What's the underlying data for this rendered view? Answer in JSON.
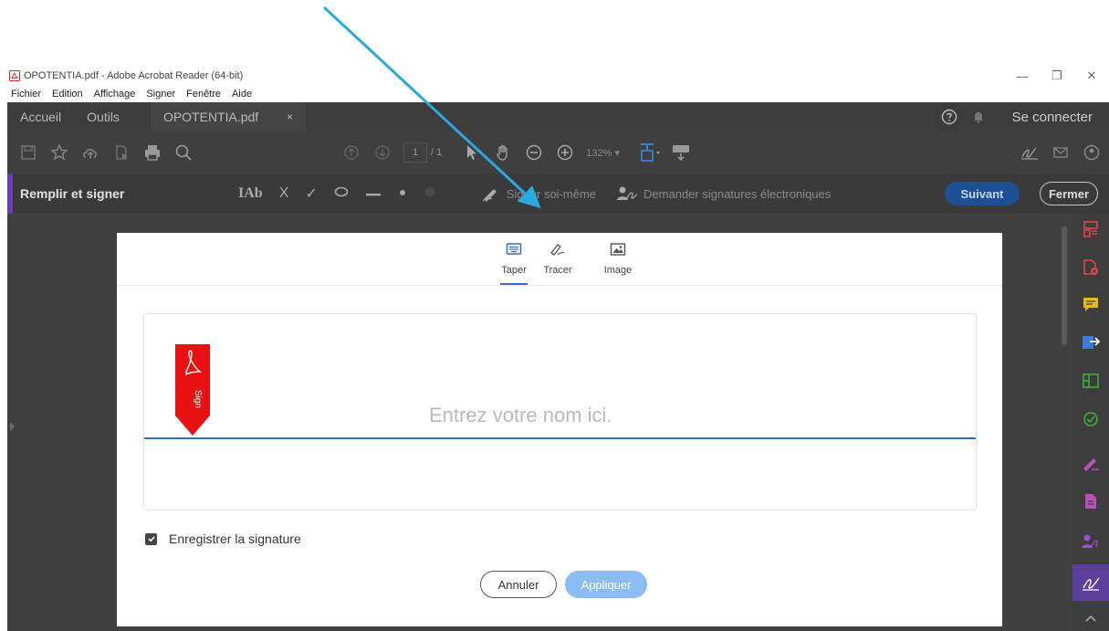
{
  "window": {
    "title": "OPOTENTIA.pdf - Adobe Acrobat Reader (64-bit)",
    "minimize": "—",
    "restore": "❐",
    "close": "✕"
  },
  "menu": [
    "Fichier",
    "Edition",
    "Affichage",
    "Signer",
    "Fenêtre",
    "Aide"
  ],
  "tabs": {
    "home": "Accueil",
    "tools": "Outils",
    "document": "OPOTENTIA.pdf",
    "document_close": "×",
    "sign_in": "Se connecter"
  },
  "toolbar": {
    "page_current": "1",
    "page_total": "/ 1",
    "zoom": "132%"
  },
  "fill_sign": {
    "label": "Remplir et signer",
    "text_tool": "IAb",
    "cross_tool": "X",
    "check_tool": "✓",
    "sign_self": "Signer soi-même",
    "request_signatures": "Demander signatures électroniques",
    "next": "Suivant",
    "close": "Fermer"
  },
  "dialog": {
    "tabs": [
      {
        "label": "Taper",
        "icon": "keyboard-icon",
        "active": true
      },
      {
        "label": "Tracer",
        "icon": "pen-icon",
        "active": false
      },
      {
        "label": "Image",
        "icon": "image-icon",
        "active": false
      }
    ],
    "ribbon_text": "Sign",
    "name_placeholder": "Entrez votre nom ici.",
    "save_signature_label": "Enregistrer la signature",
    "save_signature_checked": true,
    "cancel": "Annuler",
    "apply": "Appliquer"
  },
  "colors": {
    "accent_blue": "#2d6ec9",
    "apply_button": "#8cbcf5",
    "arrow": "#29a9e1",
    "ribbon_red": "#e81010",
    "fill_sign_accent": "#6a3fb2"
  }
}
